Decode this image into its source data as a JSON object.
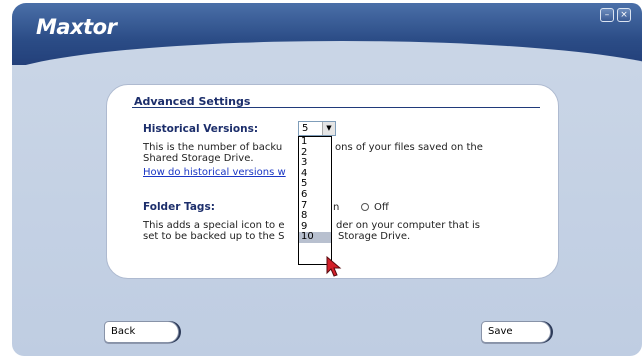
{
  "app": {
    "brand": "Maxtor",
    "window_controls": {
      "minimize_glyph": "–",
      "close_glyph": "×"
    }
  },
  "section": {
    "title": "Advanced Settings"
  },
  "historical_versions": {
    "label": "Historical Versions:",
    "selected_value": "5",
    "description_line1": "This is the number of backu",
    "description_line1_tail": "ons of your files saved on the",
    "description_line2": "Shared Storage Drive.",
    "link_text": "How do historical versions w",
    "options": [
      "1",
      "2",
      "3",
      "4",
      "5",
      "6",
      "7",
      "8",
      "9",
      "10"
    ],
    "highlighted_option": "10"
  },
  "folder_tags": {
    "label": "Folder Tags:",
    "radio_on_tail": "n",
    "radio_off_label": "Off",
    "description_line1_head": "This adds a special icon to e",
    "description_line1_tail": "der on your computer that is",
    "description_line2_head": "set to be backed up to the S",
    "description_line2_tail": "Storage Drive."
  },
  "buttons": {
    "back": "Back",
    "save": "Save"
  },
  "colors": {
    "header_blue": "#2b4c86",
    "panel_bg": "#c9d5e6",
    "title_navy": "#1c2e6b",
    "link_blue": "#1a36c4",
    "selected_option_bg": "#b8c0cf"
  },
  "icons": {
    "minimize": "minimize-icon",
    "close": "close-icon",
    "dropdown_arrow": "chevron-down-icon",
    "cursor": "mouse-pointer-icon"
  }
}
